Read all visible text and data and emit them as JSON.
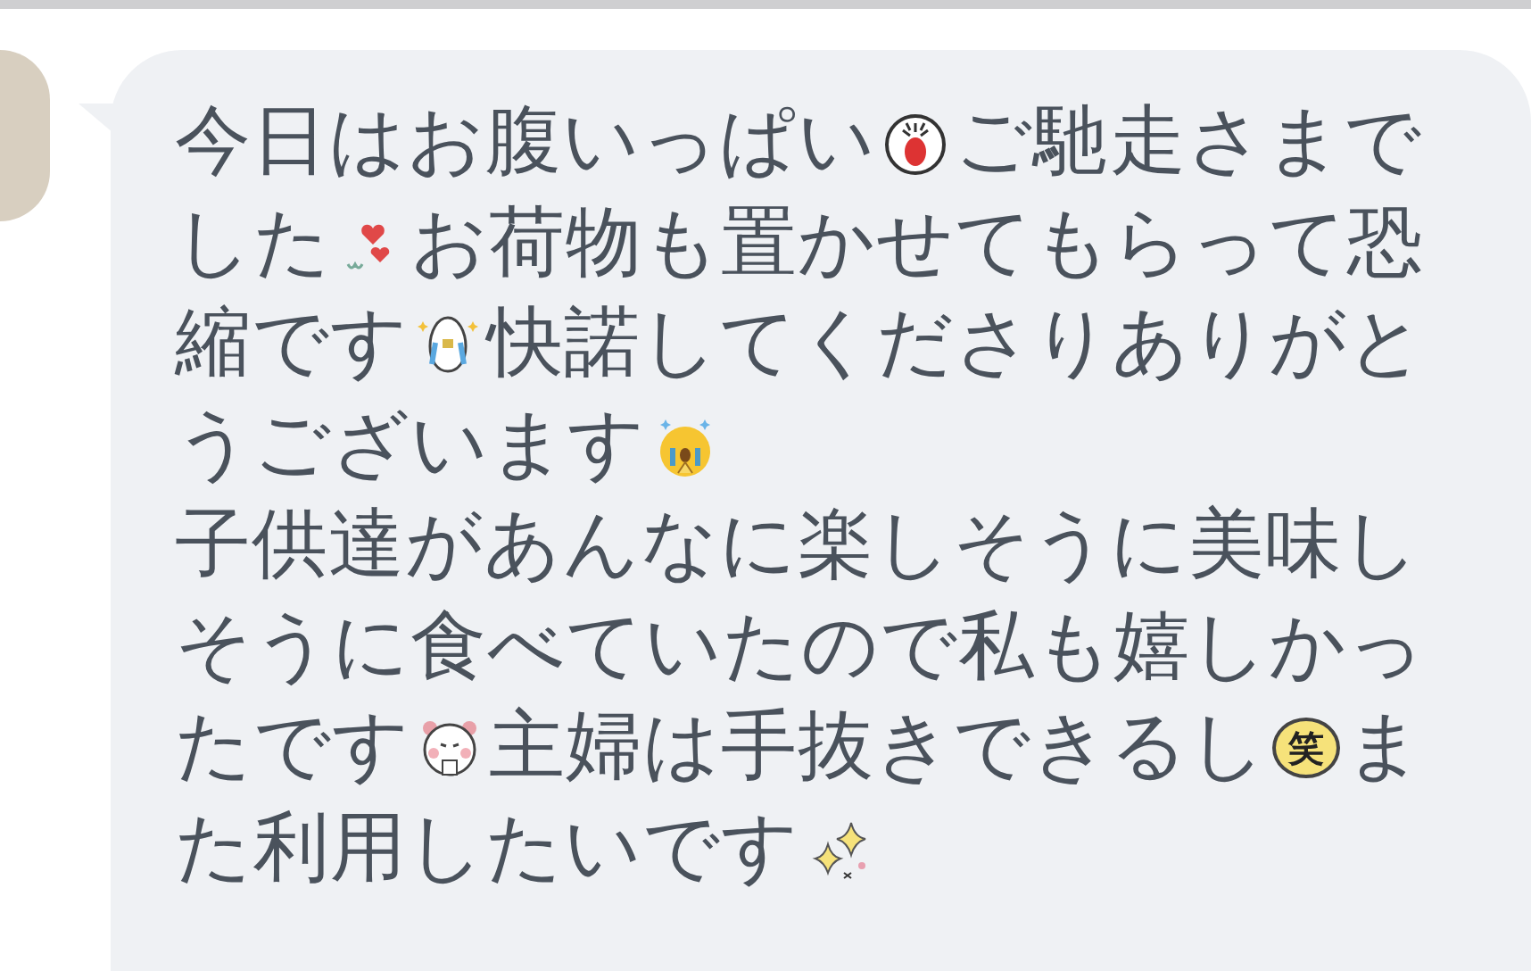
{
  "message": {
    "lines": [
      {
        "segments": [
          {
            "kind": "text",
            "text": "今日はお腹いっぱい"
          },
          {
            "kind": "screaming-face"
          },
          {
            "kind": "text",
            "text": "ご馳走さまで"
          }
        ]
      },
      {
        "segments": [
          {
            "kind": "text",
            "text": "した"
          },
          {
            "kind": "hearts"
          },
          {
            "kind": "text",
            "text": "お荷物も置かせてもらって恐"
          }
        ]
      },
      {
        "segments": [
          {
            "kind": "text",
            "text": "縮です"
          },
          {
            "kind": "crying-bird"
          },
          {
            "kind": "text",
            "text": "快諾してくださりありがと"
          }
        ]
      },
      {
        "segments": [
          {
            "kind": "text",
            "text": "うございます"
          },
          {
            "kind": "crying-face"
          }
        ]
      },
      {
        "segments": [
          {
            "kind": "text",
            "text": "子供達があんなに楽しそうに美味し"
          }
        ]
      },
      {
        "segments": [
          {
            "kind": "text",
            "text": "そうに食べていたので私も嬉しかっ"
          }
        ]
      },
      {
        "segments": [
          {
            "kind": "text",
            "text": "たです"
          },
          {
            "kind": "bear"
          },
          {
            "kind": "text",
            "text": "主婦は手抜きできるし"
          },
          {
            "kind": "badge",
            "text": "笑"
          },
          {
            "kind": "text",
            "text": "ま"
          }
        ]
      },
      {
        "segments": [
          {
            "kind": "text",
            "text": "た利用したいです"
          },
          {
            "kind": "sparkles"
          }
        ]
      }
    ]
  }
}
